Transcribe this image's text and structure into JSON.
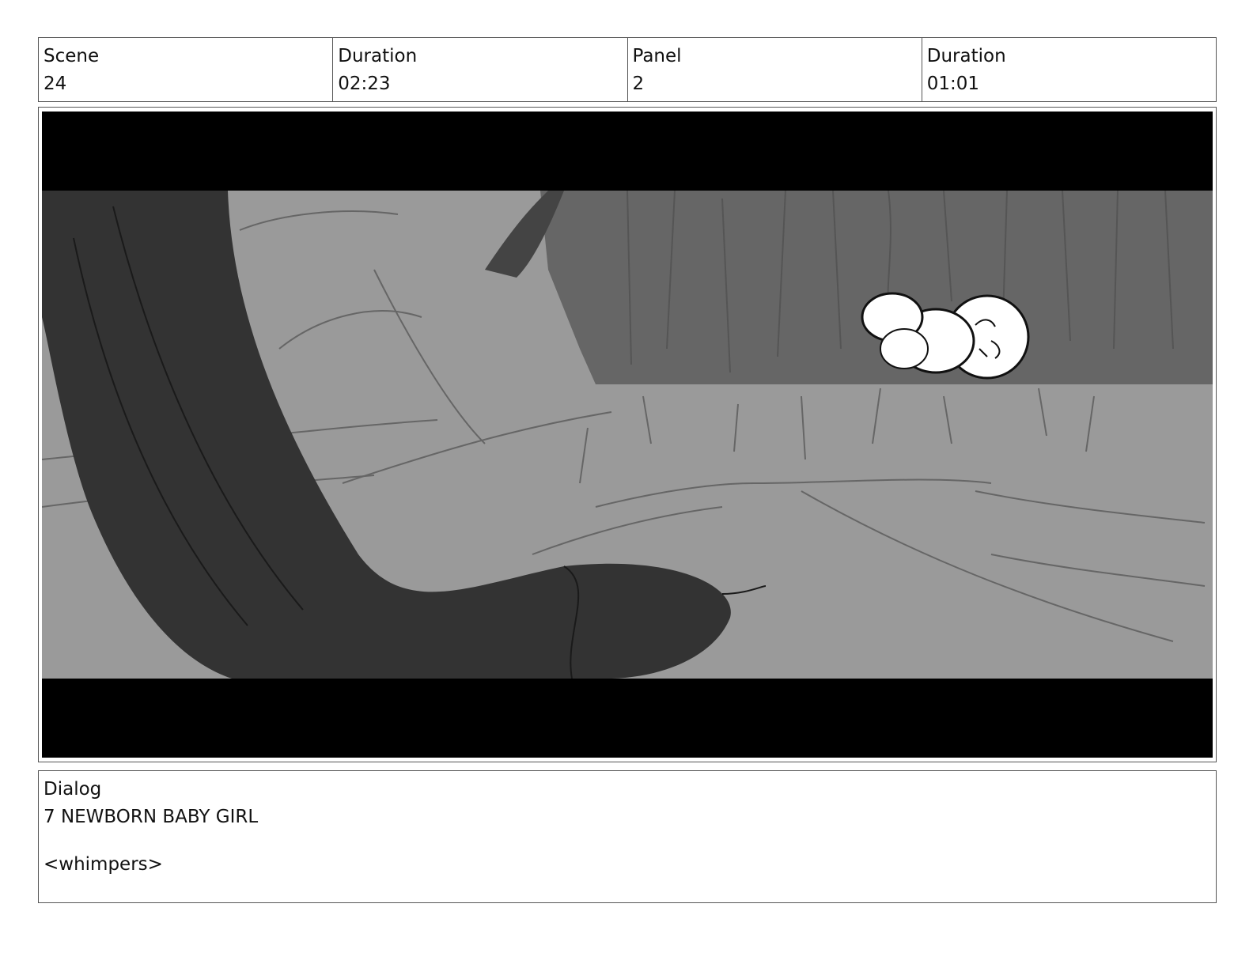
{
  "header": {
    "scene_label": "Scene",
    "scene_value": "24",
    "scene_duration_label": "Duration",
    "scene_duration_value": "02:23",
    "panel_label": "Panel",
    "panel_value": "2",
    "panel_duration_label": "Duration",
    "panel_duration_value": "01:01"
  },
  "dialog": {
    "label": "Dialog",
    "speaker": "7 NEWBORN BABY GIRL",
    "line": "<whimpers>"
  }
}
